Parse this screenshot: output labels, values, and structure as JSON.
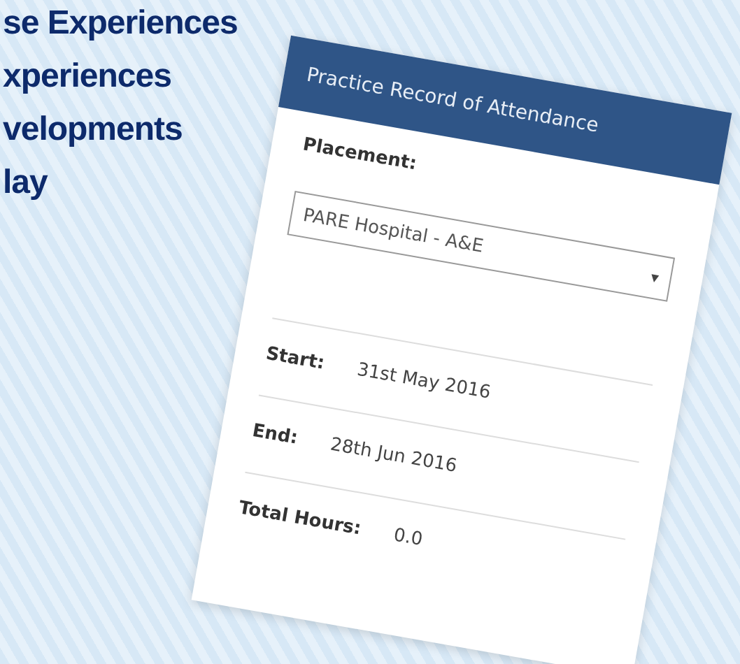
{
  "background_lines": [
    "se Experiences",
    "xperiences",
    "velopments",
    "lay"
  ],
  "card": {
    "title": "Practice Record of Attendance",
    "placement": {
      "label": "Placement:",
      "value": "PARE Hospital - A&E",
      "caret": "▾"
    },
    "fields": [
      {
        "label": "Start:",
        "value": "31st May 2016"
      },
      {
        "label": "End:",
        "value": "28th Jun 2016"
      },
      {
        "label": "Total Hours:",
        "value": "0.0"
      }
    ]
  }
}
